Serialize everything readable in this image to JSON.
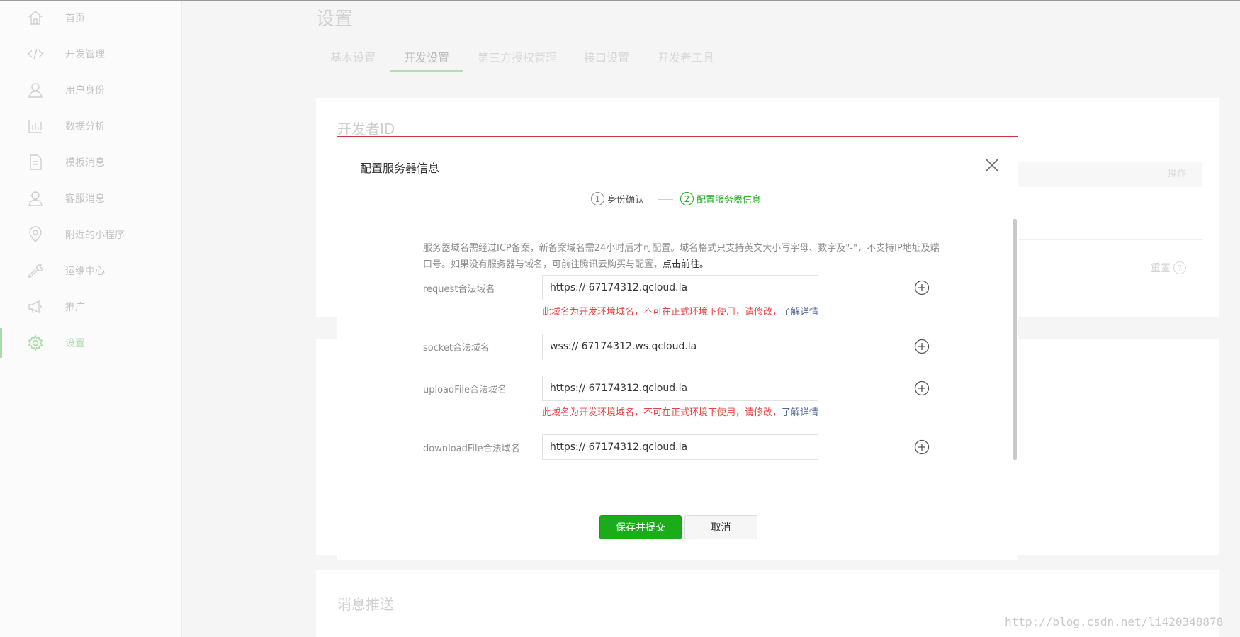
{
  "page": {
    "title": "设置"
  },
  "sidebar": {
    "items": [
      {
        "label": "首页",
        "icon": "home-icon"
      },
      {
        "label": "开发管理",
        "icon": "code-icon"
      },
      {
        "label": "用户身份",
        "icon": "user-icon"
      },
      {
        "label": "数据分析",
        "icon": "chart-icon"
      },
      {
        "label": "模板消息",
        "icon": "document-icon"
      },
      {
        "label": "客服消息",
        "icon": "headset-user-icon"
      },
      {
        "label": "附近的小程序",
        "icon": "location-pin-icon"
      },
      {
        "label": "运维中心",
        "icon": "wrench-icon"
      },
      {
        "label": "推广",
        "icon": "megaphone-icon"
      },
      {
        "label": "设置",
        "icon": "gear-icon",
        "active": true
      }
    ]
  },
  "tabs": [
    {
      "label": "基本设置"
    },
    {
      "label": "开发设置",
      "active": true
    },
    {
      "label": "第三方授权管理"
    },
    {
      "label": "接口设置"
    },
    {
      "label": "开发者工具"
    }
  ],
  "background": {
    "developer_id_title": "开发者ID",
    "operation_header": "操作",
    "reset_label": "重置",
    "reset_help": "?",
    "message_push_title": "消息推送"
  },
  "modal": {
    "title": "配置服务器信息",
    "steps": [
      {
        "num": "1",
        "label": "身份确认"
      },
      {
        "num": "2",
        "label": "配置服务器信息",
        "active": true
      }
    ],
    "notice_text": "服务器域名需经过ICP备案，新备案域名需24小时后才可配置。域名格式只支持英文大小写字母、数字及\"-\"，不支持IP地址及端口号。如果没有服务器与域名，可前往腾讯云购买与配置，",
    "notice_link": "点击前往。",
    "fields": [
      {
        "label": "request合法域名",
        "value": "https:// 67174312.qcloud.la",
        "error": "此域名为开发环境域名，不可在正式环境下使用，请修改，",
        "error_link": "了解详情"
      },
      {
        "label": "socket合法域名",
        "value": "wss:// 67174312.ws.qcloud.la"
      },
      {
        "label": "uploadFile合法域名",
        "value": "https:// 67174312.qcloud.la",
        "error": "此域名为开发环境域名，不可在正式环境下使用，请修改，",
        "error_link": "了解详情"
      },
      {
        "label": "downloadFile合法域名",
        "value": "https:// 67174312.qcloud.la"
      }
    ],
    "save_button": "保存并提交",
    "cancel_button": "取消"
  },
  "watermark": "http://blog.csdn.net/li420348878",
  "colors": {
    "primary": "#1aad19",
    "error": "#e64340",
    "link": "#576b95",
    "modal_border": "#c9363c"
  }
}
